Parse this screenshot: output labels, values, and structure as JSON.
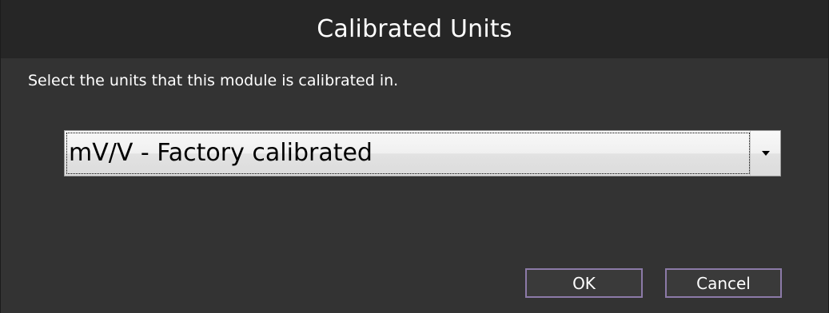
{
  "dialog": {
    "title": "Calibrated Units",
    "prompt": "Select the units that this module is calibrated in.",
    "units_select": {
      "selected": "mV/V - Factory calibrated"
    },
    "buttons": {
      "ok": "OK",
      "cancel": "Cancel"
    }
  },
  "icons": {
    "dropdown": "chevron-down-icon"
  },
  "colors": {
    "titlebar": "#262626",
    "background": "#333333",
    "button_border": "#8c7aa8",
    "text": "#ffffff"
  }
}
